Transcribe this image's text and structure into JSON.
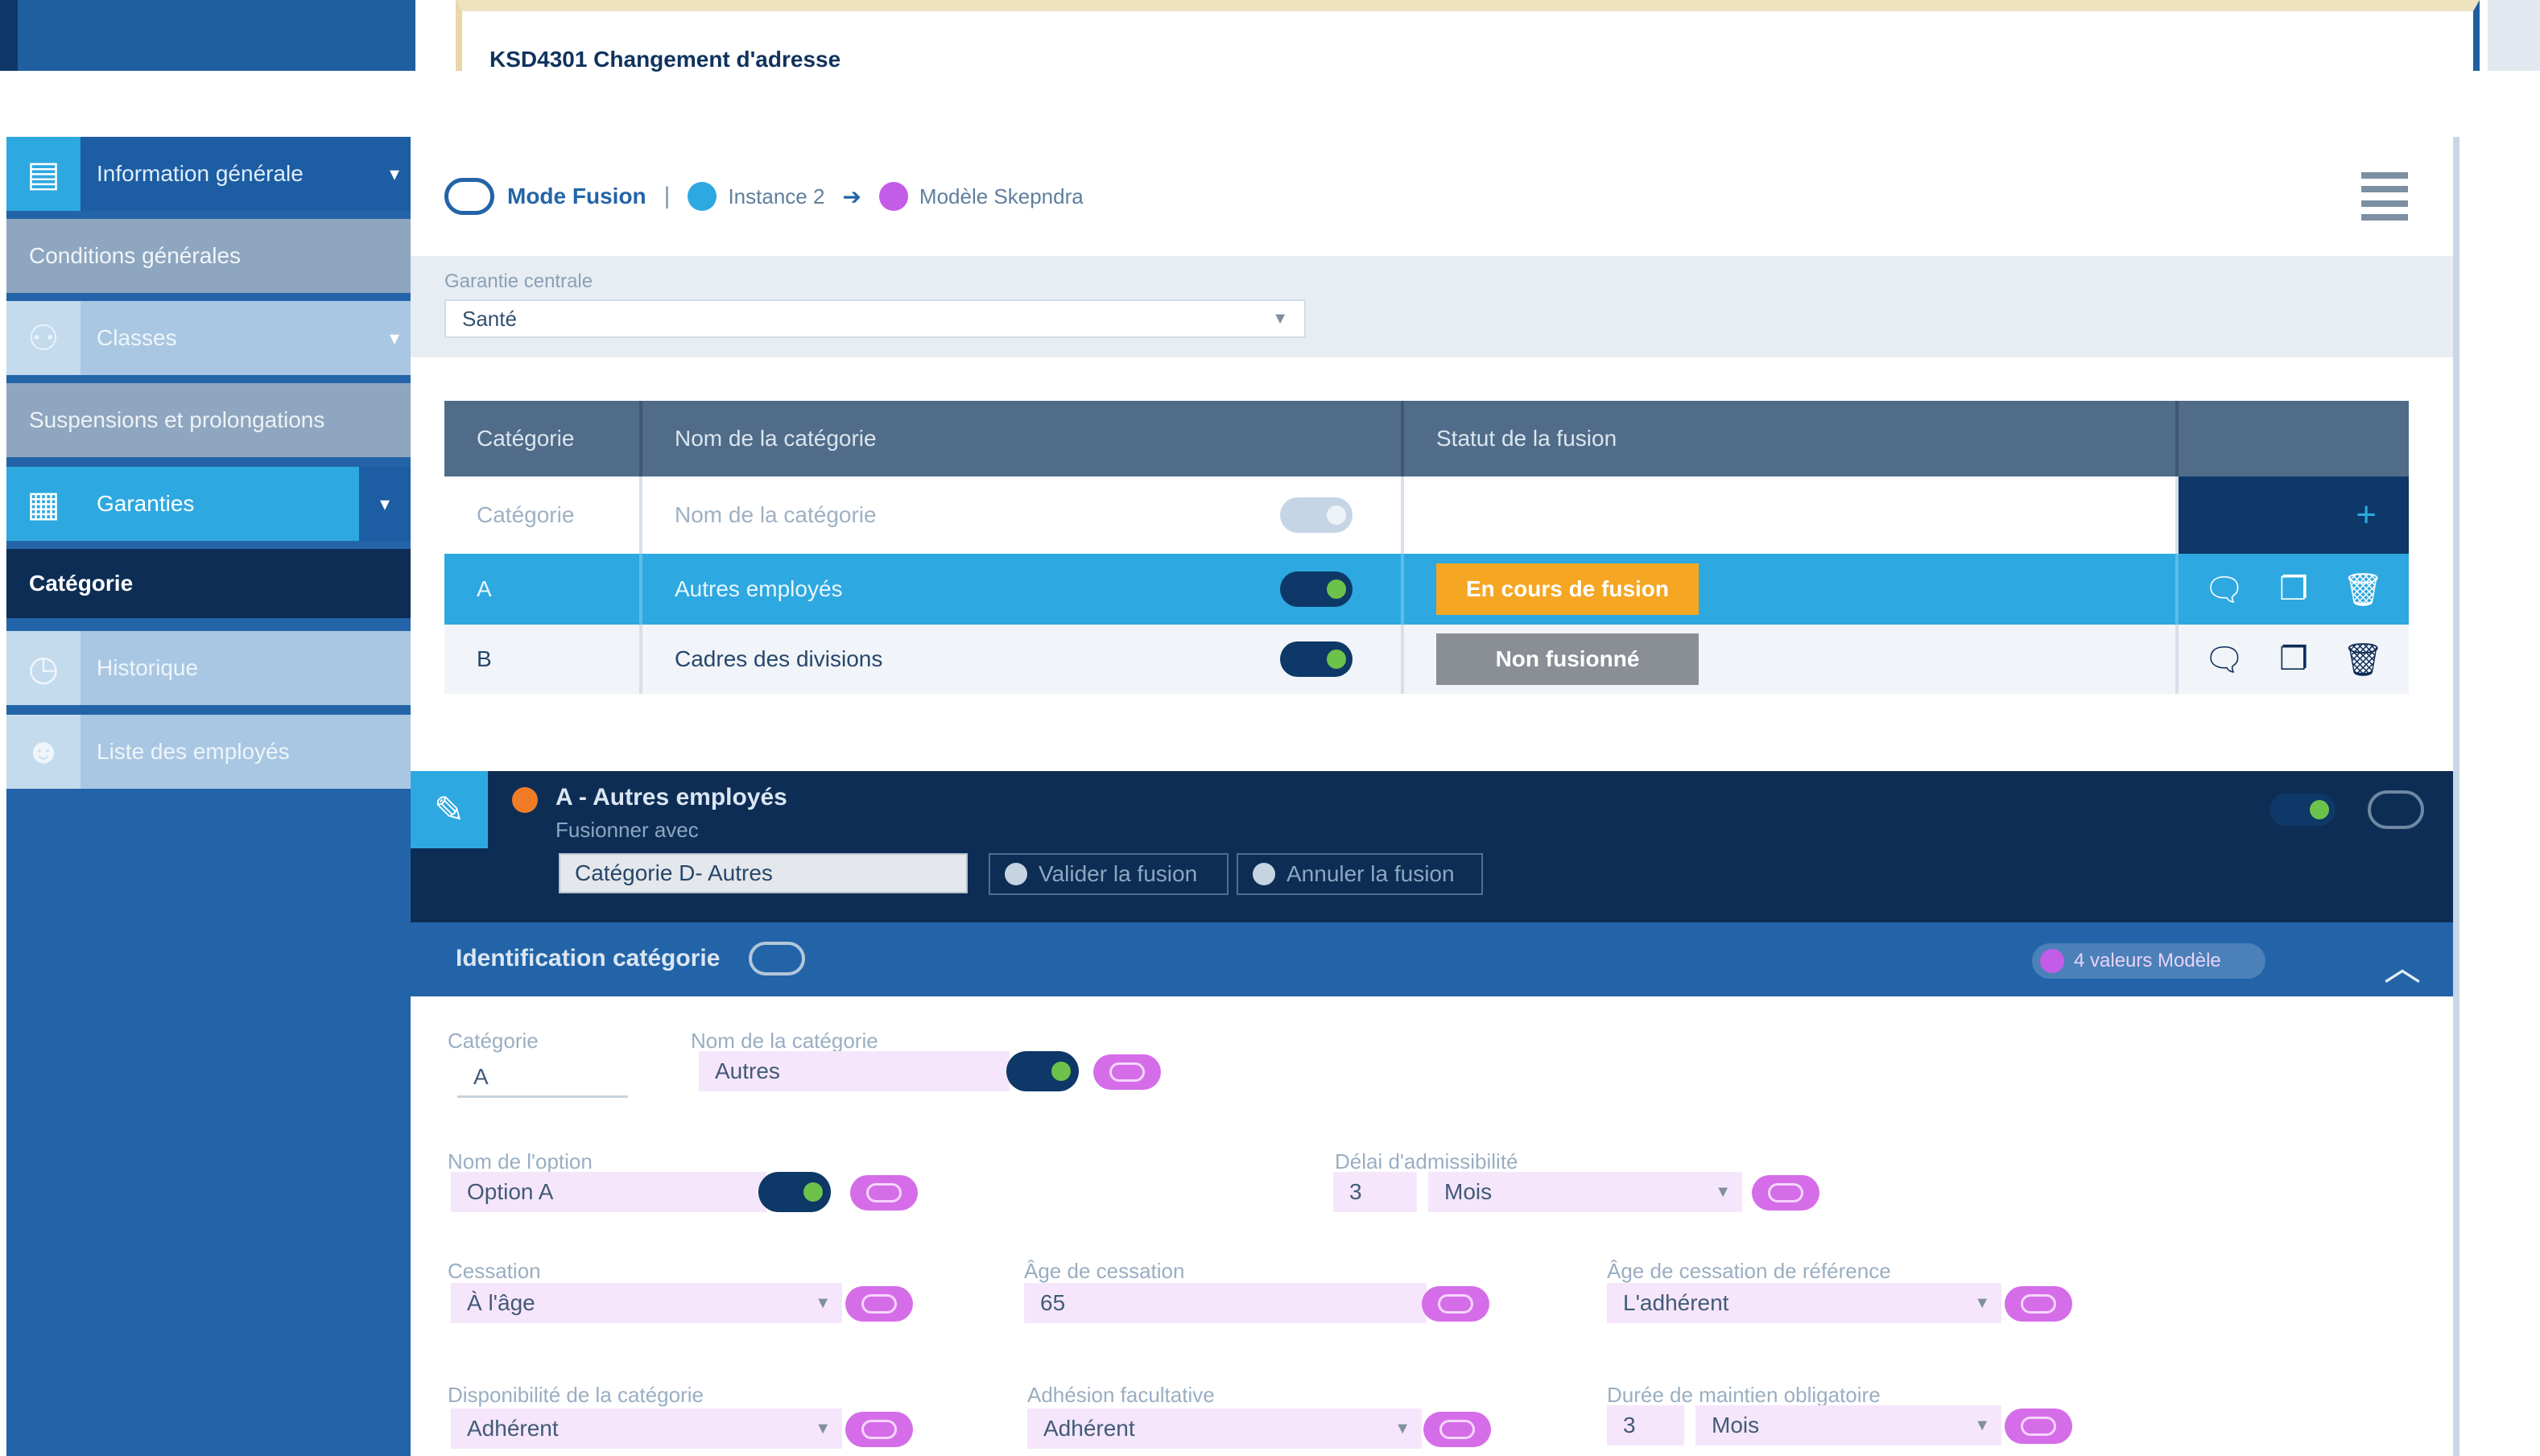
{
  "top": {
    "ticket": "KSD4301 Changement d'adresse"
  },
  "sidebar": {
    "items": [
      {
        "label": "Information générale",
        "icon": "folder-icon"
      },
      {
        "label": "Conditions générales"
      },
      {
        "label": "Classes",
        "icon": "group-icon"
      },
      {
        "label": "Suspensions et prolongations"
      },
      {
        "label": "Garanties",
        "icon": "document-icon"
      },
      {
        "label": "Catégorie"
      },
      {
        "label": "Historique",
        "icon": "history-icon"
      },
      {
        "label": "Liste des employés",
        "icon": "people-icon"
      }
    ]
  },
  "mode_bar": {
    "label": "Mode Fusion",
    "separator": "|",
    "ref_left": "Instance 2",
    "arrow": "➔",
    "ref_right": "Modèle Skepndra"
  },
  "garantie": {
    "label": "Garantie centrale",
    "value": "Santé"
  },
  "table": {
    "headers": [
      "Catégorie",
      "Nom de la catégorie",
      "Statut de la fusion",
      ""
    ],
    "filter": {
      "cat": "Catégorie",
      "name": "Nom de la catégorie"
    },
    "add_icon": "+",
    "rows": [
      {
        "cat": "A",
        "name": "Autres employés",
        "status": "En cours de fusion"
      },
      {
        "cat": "B",
        "name": "Cadres des divisions",
        "status": "Non fusionné"
      }
    ]
  },
  "fusion": {
    "title": "A - Autres employés",
    "subtitle": "Fusionner avec",
    "target": "Catégorie D- Autres",
    "validate": "Valider la fusion",
    "cancel": "Annuler la fusion"
  },
  "ident": {
    "title": "Identification catégorie",
    "pill": "4 valeurs Modèle",
    "fields": {
      "categorie": {
        "label": "Catégorie",
        "value": "A"
      },
      "nom": {
        "label": "Nom de la catégorie",
        "value": "Autres"
      },
      "option": {
        "label": "Nom de l'option",
        "value": "Option A"
      },
      "delai": {
        "label": "Délai d'admissibilité",
        "num": "3",
        "unit": "Mois"
      },
      "cessation": {
        "label": "Cessation",
        "value": "À l'âge"
      },
      "age": {
        "label": "Âge de cessation",
        "value": "65"
      },
      "age_ref": {
        "label": "Âge de cessation de référence",
        "value": "L'adhérent"
      },
      "dispo": {
        "label": "Disponibilité de la catégorie",
        "value": "Adhérent"
      },
      "adhesion": {
        "label": "Adhésion facultative",
        "value": "Adhérent"
      },
      "duree": {
        "label": "Durée de maintien obligatoire",
        "num": "3",
        "unit": "Mois"
      }
    }
  }
}
